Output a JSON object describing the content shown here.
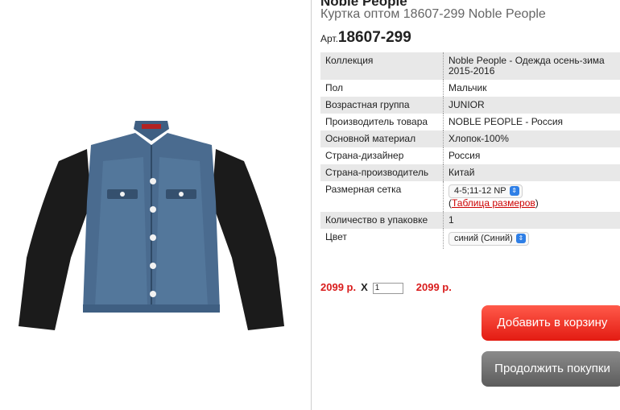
{
  "product": {
    "brand": "Noble People",
    "subtitle": "Куртка оптом 18607-299 Noble People",
    "art_prefix": "Арт.",
    "art_number": "18607-299"
  },
  "specs": [
    {
      "label": "Коллекция",
      "value": "Noble People - Одежда осень-зима 2015-2016"
    },
    {
      "label": "Пол",
      "value": "Мальчик"
    },
    {
      "label": "Возрастная группа",
      "value": "JUNIOR"
    },
    {
      "label": "Производитель товара",
      "value": "NOBLE PEOPLE - Россия"
    },
    {
      "label": "Основной материал",
      "value": "Хлопок-100%"
    },
    {
      "label": "Страна-дизайнер",
      "value": "Россия"
    },
    {
      "label": "Страна-производитель",
      "value": "Китай"
    },
    {
      "label": "Размерная сетка",
      "size_selected": "4-5;11-12 NP",
      "open_paren": "(",
      "sizes_link": "Таблица размеров",
      "close_paren": ")"
    },
    {
      "label": "Количество в упаковке",
      "value": "1"
    },
    {
      "label": "Цвет",
      "color_selected": "синий (Синий)"
    }
  ],
  "price": {
    "unit_price": "2099 р.",
    "times": "X",
    "quantity": "1",
    "total": "2099 р."
  },
  "buttons": {
    "add_to_cart": "Добавить в корзину",
    "continue_shopping": "Продолжить  покупки"
  }
}
